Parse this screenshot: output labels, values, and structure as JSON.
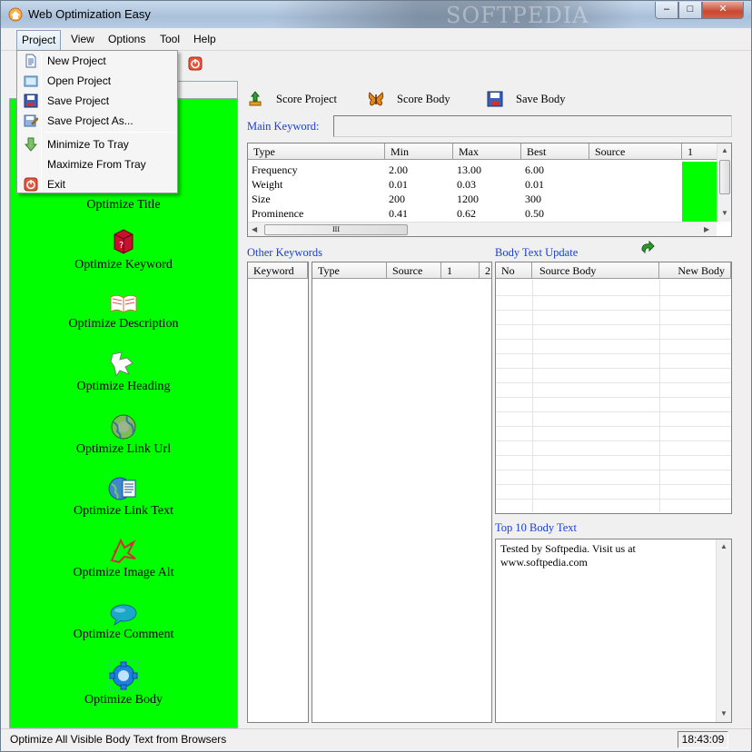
{
  "window": {
    "title": "Web Optimization Easy",
    "watermark": "SOFTPEDIA",
    "min_label": "–",
    "max_label": "□",
    "close_label": "✕"
  },
  "menubar": {
    "items": [
      "Project",
      "View",
      "Options",
      "Tool",
      "Help"
    ]
  },
  "project_menu": {
    "items": [
      {
        "label": "New Project",
        "icon": "new-document-icon"
      },
      {
        "label": "Open Project",
        "icon": "open-folder-icon"
      },
      {
        "label": "Save Project",
        "icon": "floppy-disk-icon"
      },
      {
        "label": "Save Project As...",
        "icon": "save-as-icon"
      },
      {
        "label": "Minimize To Tray",
        "icon": "down-arrow-icon"
      },
      {
        "label": "Maximize From Tray",
        "icon": ""
      },
      {
        "label": "Exit",
        "icon": "exit-icon"
      }
    ]
  },
  "optimize_panel": {
    "items": [
      {
        "label": "Optimize Title",
        "icon": "title-icon"
      },
      {
        "label": "Optimize Keyword",
        "icon": "keyword-icon"
      },
      {
        "label": "Optimize Description",
        "icon": "book-icon"
      },
      {
        "label": "Optimize Heading",
        "icon": "heading-icon"
      },
      {
        "label": "Optimize Link Url",
        "icon": "globe-icon"
      },
      {
        "label": "Optimize Link Text",
        "icon": "globe-document-icon"
      },
      {
        "label": "Optimize Image Alt",
        "icon": "image-alt-icon"
      },
      {
        "label": "Optimize Comment",
        "icon": "speech-bubble-icon"
      },
      {
        "label": "Optimize Body",
        "icon": "gear-icon"
      }
    ]
  },
  "actions": {
    "score_project": "Score Project",
    "score_body": "Score Body",
    "save_body": "Save Body"
  },
  "main_keyword": {
    "label": "Main Keyword:",
    "value": ""
  },
  "metrics_table": {
    "columns": [
      "Type",
      "Min",
      "Max",
      "Best",
      "Source",
      "1"
    ],
    "rows": [
      [
        "Frequency",
        "2.00",
        "13.00",
        "6.00"
      ],
      [
        "Weight",
        "0.01",
        "0.03",
        "0.01"
      ],
      [
        "Size",
        "200",
        "1200",
        "300"
      ],
      [
        "Prominence",
        "0.41",
        "0.62",
        "0.50"
      ]
    ],
    "hscroll_grip": "III",
    "accent_color": "#00ff00"
  },
  "other_keywords": {
    "label": "Other Keywords",
    "keyword_column": "Keyword",
    "columns": [
      "Type",
      "Source",
      "1",
      "2"
    ]
  },
  "body_text_update": {
    "label": "Body Text Update",
    "columns": [
      "No",
      "Source Body",
      "New Body"
    ]
  },
  "top10": {
    "label": "Top 10 Body Text",
    "text_line1": "Tested by Softpedia. Visit us at",
    "text_line2": "www.softpedia.com"
  },
  "status": {
    "text": "Optimize All Visible Body Text from Browsers",
    "clock": "18:43:09"
  },
  "colors": {
    "panel_green": "#00ff00",
    "label_blue": "#1b3dd6"
  }
}
